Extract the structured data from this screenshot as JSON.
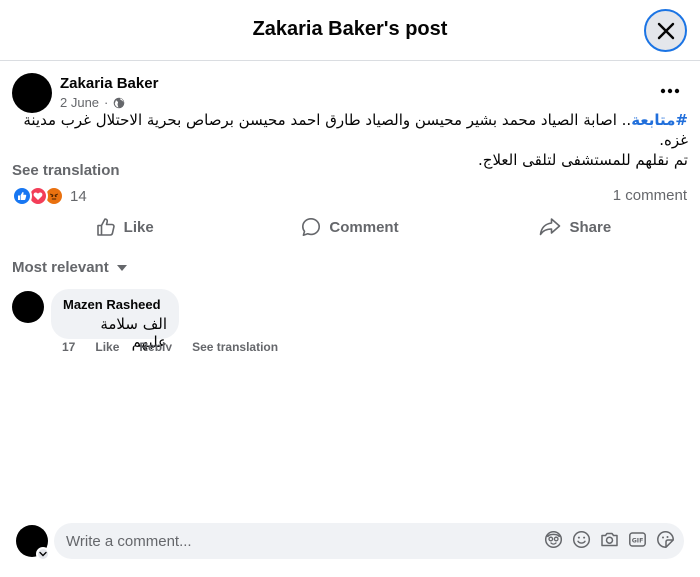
{
  "header": {
    "title": "Zakaria Baker's post"
  },
  "post": {
    "author": "Zakaria Baker",
    "date": "2 June",
    "hashtag": "#متابعة",
    "text_line1": ".. اصابة الصياد محمد بشير محيسن والصياد طارق احمد محيسن برصاص بحرية الاحتلال غرب مدينة غزه.",
    "text_line2": "تم نقلهم للمستشفى لتلقى العلاج.",
    "see_translation": "See translation",
    "reaction_count": "14",
    "comment_count": "1 comment",
    "reactions": [
      "like",
      "love",
      "angry"
    ]
  },
  "actions": {
    "like": "Like",
    "comment": "Comment",
    "share": "Share"
  },
  "sort": {
    "label": "Most relevant"
  },
  "comments": [
    {
      "author": "Mazen Rasheed",
      "text": "الف سلامة عليهم",
      "time": "17",
      "like": "Like",
      "reply": "Reply",
      "see_translation": "See translation"
    }
  ],
  "composer": {
    "placeholder": "Write a comment..."
  },
  "colors": {
    "accent": "#1877f2",
    "hashtag": "#216fdb",
    "secondary_text": "#65676b",
    "bubble_bg": "#f0f2f5",
    "love": "#f33e58",
    "angry": "#e9710f"
  }
}
